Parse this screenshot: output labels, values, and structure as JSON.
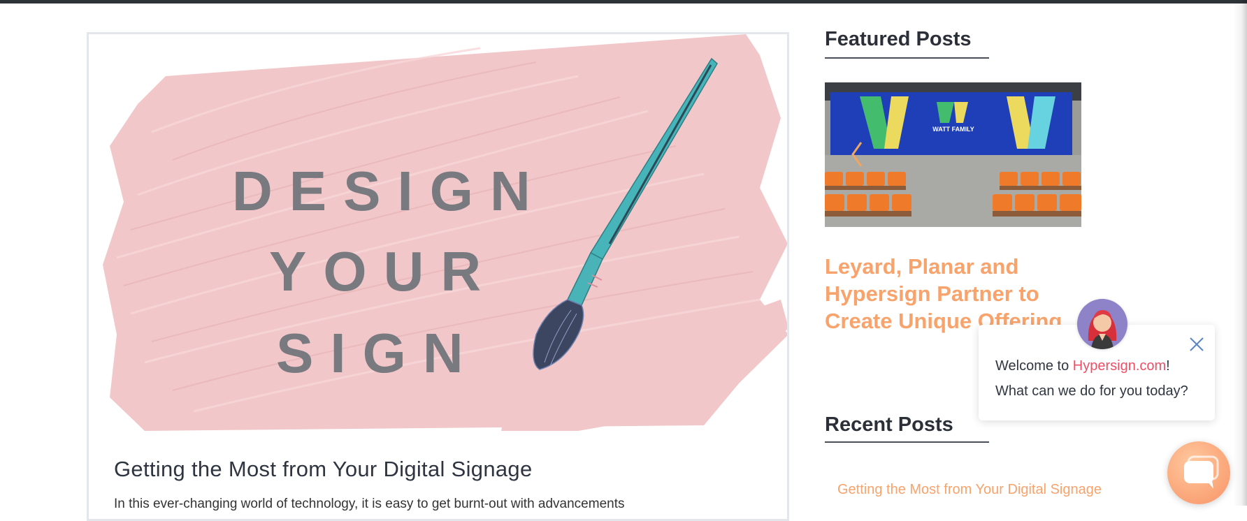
{
  "article": {
    "hero_lines": [
      "DESIGN",
      "YOUR",
      "SIGN"
    ],
    "title": "Getting the Most from Your Digital Signage",
    "excerpt": "In this ever-changing world of technology, it is easy to get burnt-out with advancements"
  },
  "sidebar": {
    "featured": {
      "heading": "Featured Posts",
      "image_sign_text": "WATT FAMILY",
      "post_title": "Leyard, Planar and Hypersign Partner to Create Unique Offering"
    },
    "recent": {
      "heading": "Recent Posts",
      "first_link": "Getting the Most from Your Digital Signage"
    }
  },
  "chat": {
    "welcome_prefix": "Welcome to ",
    "brand": "Hypersign.com",
    "welcome_suffix": "!",
    "question": "What can we do for you today?"
  },
  "icons": [
    "close-icon",
    "chevron-left-icon",
    "chat-bubble-icon",
    "paintbrush-icon"
  ],
  "colors": {
    "accent_orange": "#f8a36c",
    "brand_pink": "#ef4f66",
    "topbar": "#2d3339",
    "hero_pink": "#f2c7c9",
    "brush_teal": "#4ab3b8"
  }
}
